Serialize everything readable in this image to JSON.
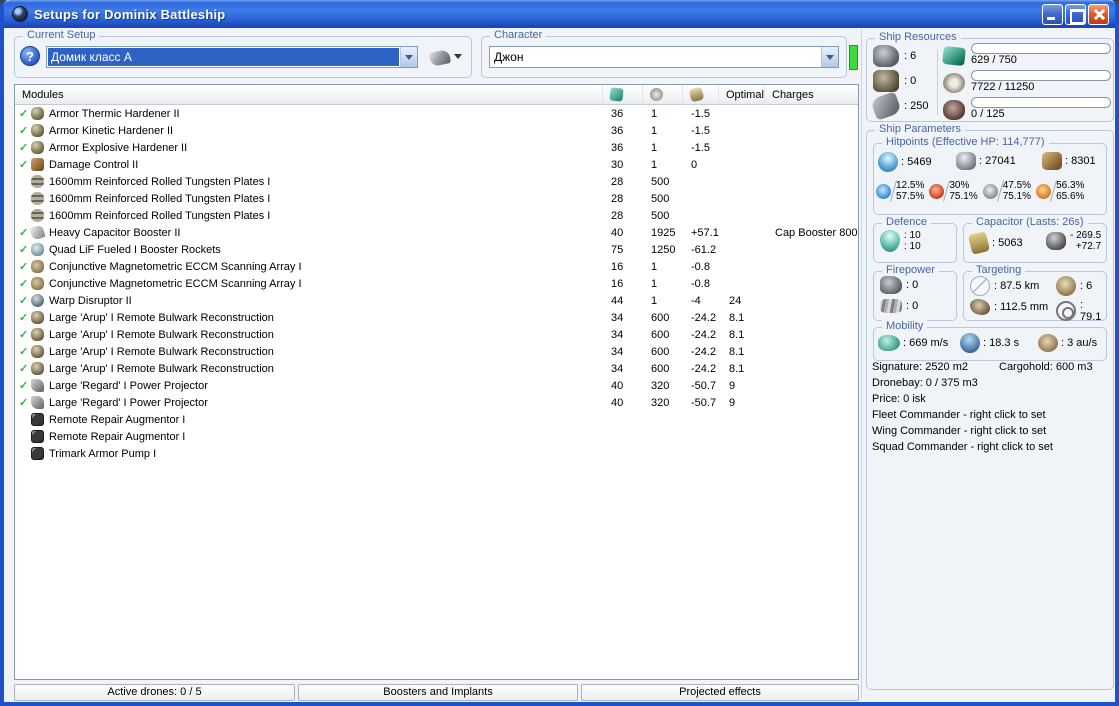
{
  "window": {
    "title": "Setups for Dominix Battleship"
  },
  "setup": {
    "label": "Current Setup",
    "value": "Домик класс А",
    "help": "?"
  },
  "character": {
    "label": "Character",
    "value": "Джон"
  },
  "modules_table": {
    "header": {
      "name": "Modules",
      "optimal": "Optimal",
      "charges": "Charges"
    },
    "rows": [
      {
        "fitted": true,
        "icon": "armor-hardener",
        "name": "Armor Thermic Hardener II",
        "cpu": "36",
        "pg": "1",
        "cap": "-1.5",
        "optimal": "",
        "charge": ""
      },
      {
        "fitted": true,
        "icon": "armor-hardener",
        "name": "Armor Kinetic Hardener II",
        "cpu": "36",
        "pg": "1",
        "cap": "-1.5",
        "optimal": "",
        "charge": ""
      },
      {
        "fitted": true,
        "icon": "armor-hardener",
        "name": "Armor Explosive Hardener II",
        "cpu": "36",
        "pg": "1",
        "cap": "-1.5",
        "optimal": "",
        "charge": ""
      },
      {
        "fitted": true,
        "icon": "damage-control",
        "name": "Damage Control II",
        "cpu": "30",
        "pg": "1",
        "cap": "0",
        "optimal": "",
        "charge": ""
      },
      {
        "fitted": false,
        "icon": "armor-plate",
        "name": "1600mm Reinforced Rolled Tungsten Plates I",
        "cpu": "28",
        "pg": "500",
        "cap": "",
        "optimal": "",
        "charge": ""
      },
      {
        "fitted": false,
        "icon": "armor-plate",
        "name": "1600mm Reinforced Rolled Tungsten Plates I",
        "cpu": "28",
        "pg": "500",
        "cap": "",
        "optimal": "",
        "charge": ""
      },
      {
        "fitted": false,
        "icon": "armor-plate",
        "name": "1600mm Reinforced Rolled Tungsten Plates I",
        "cpu": "28",
        "pg": "500",
        "cap": "",
        "optimal": "",
        "charge": ""
      },
      {
        "fitted": true,
        "icon": "cap-booster",
        "name": "Heavy Capacitor Booster II",
        "cpu": "40",
        "pg": "1925",
        "cap": "+57.1",
        "optimal": "",
        "charge": "Cap Booster 800"
      },
      {
        "fitted": true,
        "icon": "booster-rockets",
        "name": "Quad LiF Fueled I Booster Rockets",
        "cpu": "75",
        "pg": "1250",
        "cap": "-61.2",
        "optimal": "",
        "charge": ""
      },
      {
        "fitted": true,
        "icon": "eccm-array",
        "name": "Conjunctive Magnetometric ECCM Scanning Array I",
        "cpu": "16",
        "pg": "1",
        "cap": "-0.8",
        "optimal": "",
        "charge": ""
      },
      {
        "fitted": true,
        "icon": "eccm-array",
        "name": "Conjunctive Magnetometric ECCM Scanning Array I",
        "cpu": "16",
        "pg": "1",
        "cap": "-0.8",
        "optimal": "",
        "charge": ""
      },
      {
        "fitted": true,
        "icon": "warp-disruptor",
        "name": "Warp Disruptor II",
        "cpu": "44",
        "pg": "1",
        "cap": "-4",
        "optimal": "24",
        "charge": ""
      },
      {
        "fitted": true,
        "icon": "remote-armor-repairer",
        "name": "Large 'Arup' I Remote Bulwark Reconstruction",
        "cpu": "34",
        "pg": "600",
        "cap": "-24.2",
        "optimal": "8.1",
        "charge": ""
      },
      {
        "fitted": true,
        "icon": "remote-armor-repairer",
        "name": "Large 'Arup' I Remote Bulwark Reconstruction",
        "cpu": "34",
        "pg": "600",
        "cap": "-24.2",
        "optimal": "8.1",
        "charge": ""
      },
      {
        "fitted": true,
        "icon": "remote-armor-repairer",
        "name": "Large 'Arup' I Remote Bulwark Reconstruction",
        "cpu": "34",
        "pg": "600",
        "cap": "-24.2",
        "optimal": "8.1",
        "charge": ""
      },
      {
        "fitted": true,
        "icon": "remote-armor-repairer",
        "name": "Large 'Arup' I Remote Bulwark Reconstruction",
        "cpu": "34",
        "pg": "600",
        "cap": "-24.2",
        "optimal": "8.1",
        "charge": ""
      },
      {
        "fitted": true,
        "icon": "power-projector",
        "name": "Large 'Regard' I Power Projector",
        "cpu": "40",
        "pg": "320",
        "cap": "-50.7",
        "optimal": "9",
        "charge": ""
      },
      {
        "fitted": true,
        "icon": "power-projector",
        "name": "Large 'Regard' I Power Projector",
        "cpu": "40",
        "pg": "320",
        "cap": "-50.7",
        "optimal": "9",
        "charge": ""
      },
      {
        "fitted": false,
        "icon": "rig",
        "name": "Remote Repair Augmentor I",
        "cpu": "",
        "pg": "",
        "cap": "",
        "optimal": "",
        "charge": ""
      },
      {
        "fitted": false,
        "icon": "rig",
        "name": "Remote Repair Augmentor I",
        "cpu": "",
        "pg": "",
        "cap": "",
        "optimal": "",
        "charge": ""
      },
      {
        "fitted": false,
        "icon": "rig",
        "name": "Trimark Armor Pump I",
        "cpu": "",
        "pg": "",
        "cap": "",
        "optimal": "",
        "charge": ""
      }
    ]
  },
  "ship_resources": {
    "label": "Ship Resources",
    "turrets": ": 6",
    "launchers": ": 0",
    "calibration": ": 250",
    "cpu": "629 / 750",
    "powergrid": "7722 / 11250",
    "drones": "0 / 125"
  },
  "ship_parameters": {
    "label": "Ship Parameters",
    "hitpoints": {
      "label": "Hitpoints (Effective HP: 114,777)",
      "shield": ": 5469",
      "armor": ": 27041",
      "structure": ": 8301",
      "resists": [
        {
          "type": "em",
          "top": "12.5%",
          "bottom": "57.5%"
        },
        {
          "type": "thermal",
          "top": "30%",
          "bottom": "75.1%"
        },
        {
          "type": "kinetic",
          "top": "47.5%",
          "bottom": "75.1%"
        },
        {
          "type": "explosive",
          "top": "56.3%",
          "bottom": "65.6%"
        }
      ]
    },
    "defence": {
      "label": "Defence",
      "top": ": 10",
      "bottom": ": 10"
    },
    "capacitor": {
      "label": "Capacitor (Lasts: 26s)",
      "amount": ": 5063",
      "out": "- 269.5",
      "in": "+72.7"
    },
    "firepower": {
      "label": "Firepower",
      "turret": ": 0",
      "missile": ": 0"
    },
    "targeting": {
      "label": "Targeting",
      "range": ": 87.5 km",
      "max_targets": ": 6",
      "scan_res": ": 112.5 mm",
      "sensor_strength": ": 79.1"
    },
    "mobility": {
      "label": "Mobility",
      "speed": ": 669 m/s",
      "agility": ": 18.3 s",
      "warp_speed": ": 3 au/s"
    },
    "stats": {
      "signature": "Signature: 2520 m2",
      "cargohold": "Cargohold: 600 m3",
      "dronebay": "Dronebay: 0 / 375 m3",
      "price": "Price: 0 isk",
      "fleet": "Fleet Commander - right click to set",
      "wing": "Wing Commander - right click to set",
      "squad": "Squad Commander - right click to set"
    }
  },
  "bottom": {
    "drones": "Active drones: 0 / 5",
    "boosters": "Boosters and Implants",
    "projected": "Projected effects"
  },
  "colors": {
    "accent_green": "#3ED43E",
    "title_blue": "#2A61D4",
    "selection_blue": "#2E63C6"
  }
}
